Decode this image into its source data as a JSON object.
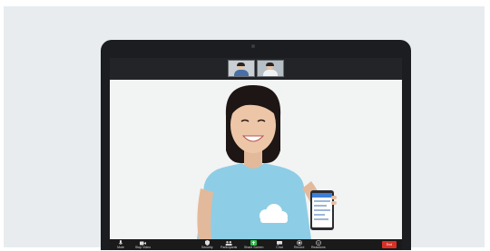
{
  "meeting": {
    "thumbnails": [
      {
        "name": "participant-1",
        "bg": "#c9cfd4",
        "shirt": "#4a6fa5"
      },
      {
        "name": "participant-2",
        "bg": "#b7bfc6",
        "shirt": "#f2f2f2"
      }
    ],
    "toolbar": {
      "mute": "Mute",
      "stop_video": "Stop Video",
      "security": "Security",
      "participants": "Participants",
      "share_screen": "Share Screen",
      "chat": "Chat",
      "record": "Record",
      "reactions": "Reactions",
      "end": "End"
    },
    "colors": {
      "share_accent": "#2fbf4a",
      "end_button": "#d93025",
      "shirt": "#8ecde6"
    },
    "icons": [
      "microphone-icon",
      "video-camera-icon",
      "shield-icon",
      "participants-icon",
      "share-screen-icon",
      "chat-icon",
      "record-icon",
      "reactions-icon"
    ]
  }
}
